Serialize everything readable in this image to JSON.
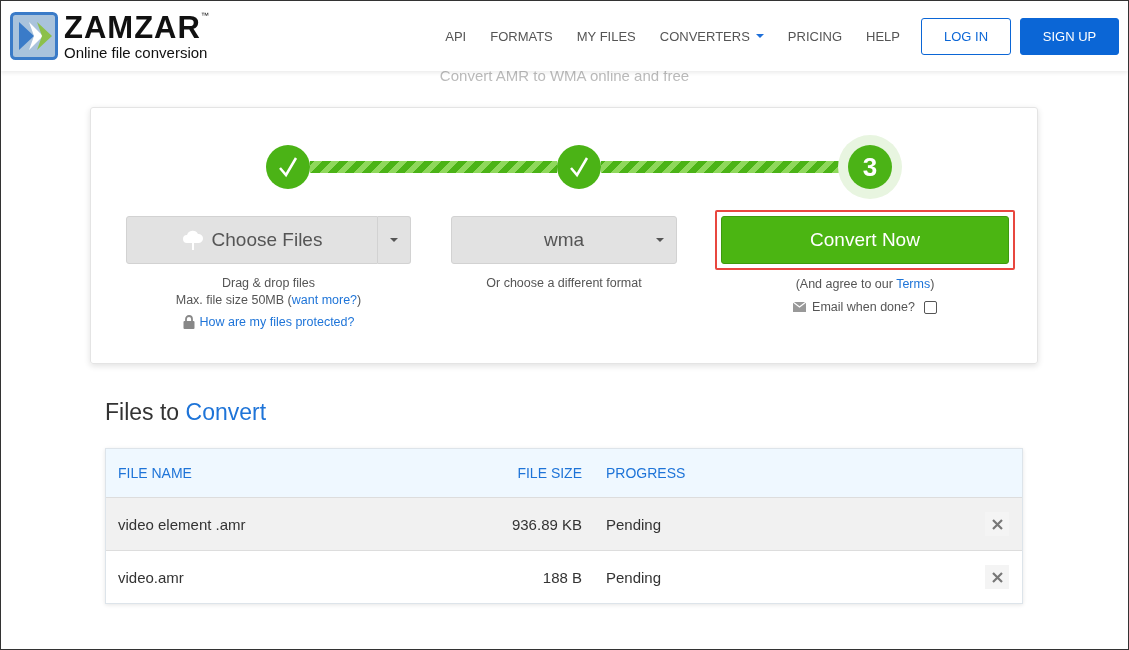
{
  "header": {
    "brand": "ZAMZAR",
    "trademark": "™",
    "tagline": "Online file conversion",
    "nav": [
      {
        "label": "API",
        "dropdown": false
      },
      {
        "label": "FORMATS",
        "dropdown": false
      },
      {
        "label": "MY FILES",
        "dropdown": false
      },
      {
        "label": "CONVERTERS",
        "dropdown": true
      },
      {
        "label": "PRICING",
        "dropdown": false
      },
      {
        "label": "HELP",
        "dropdown": false
      }
    ],
    "login": "LOG IN",
    "signup": "SIGN UP"
  },
  "subtitle": "Convert AMR to WMA online and free",
  "steps": [
    {
      "done": true
    },
    {
      "done": true
    },
    {
      "done": false,
      "number": "3"
    }
  ],
  "connectors": [
    {
      "level": 1
    },
    {
      "level": 1
    }
  ],
  "choose": {
    "label": "Choose Files",
    "hint": "Drag & drop files",
    "limit": "Max. file size 50MB (",
    "limit_link": "want more?",
    "limit_end": ")",
    "protect_link": "How are my files protected?"
  },
  "format": {
    "value": "wma",
    "hint": "Or choose a different format"
  },
  "convert": {
    "label": "Convert Now",
    "highlighted": true,
    "agree": "(And agree to our ",
    "terms": "Terms",
    "agree_end": ")",
    "email": "Email when done?",
    "email_checked": false
  },
  "files": {
    "title_plain": "Files to",
    "title_accent": "Convert",
    "columns": [
      "FILE NAME",
      "FILE SIZE",
      "PROGRESS"
    ],
    "rows": [
      {
        "name": "video element .amr",
        "size": "936.89 KB",
        "progress": "Pending",
        "highlighted": true
      },
      {
        "name": "video.amr",
        "size": "188 B",
        "progress": "Pending",
        "highlighted": false
      }
    ]
  }
}
